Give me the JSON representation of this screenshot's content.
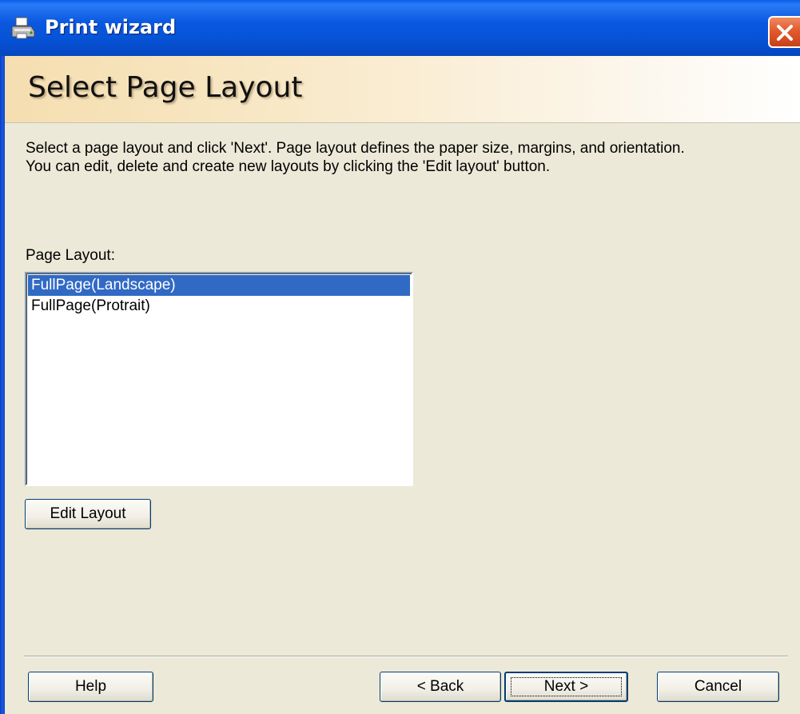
{
  "window": {
    "title": "Print wizard",
    "icon": "printer-icon",
    "close_icon": "close-icon"
  },
  "header": {
    "title": "Select Page Layout"
  },
  "description": {
    "line1": "Select a page layout and click 'Next'. Page layout defines the paper size, margins, and orientation.",
    "line2": "You can edit, delete and create new layouts by clicking the 'Edit layout' button."
  },
  "layout_list": {
    "label": "Page Layout:",
    "items": [
      {
        "label": "FullPage(Landscape)",
        "selected": true
      },
      {
        "label": "FullPage(Protrait)",
        "selected": false
      }
    ]
  },
  "buttons": {
    "edit_layout": "Edit Layout",
    "help": "Help",
    "back": "< Back",
    "next": "Next >",
    "cancel": "Cancel"
  },
  "colors": {
    "titlebar": "#0a58e0",
    "selection": "#316ac5",
    "dialog_bg": "#ece9d8",
    "close_button": "#e25a2c"
  }
}
